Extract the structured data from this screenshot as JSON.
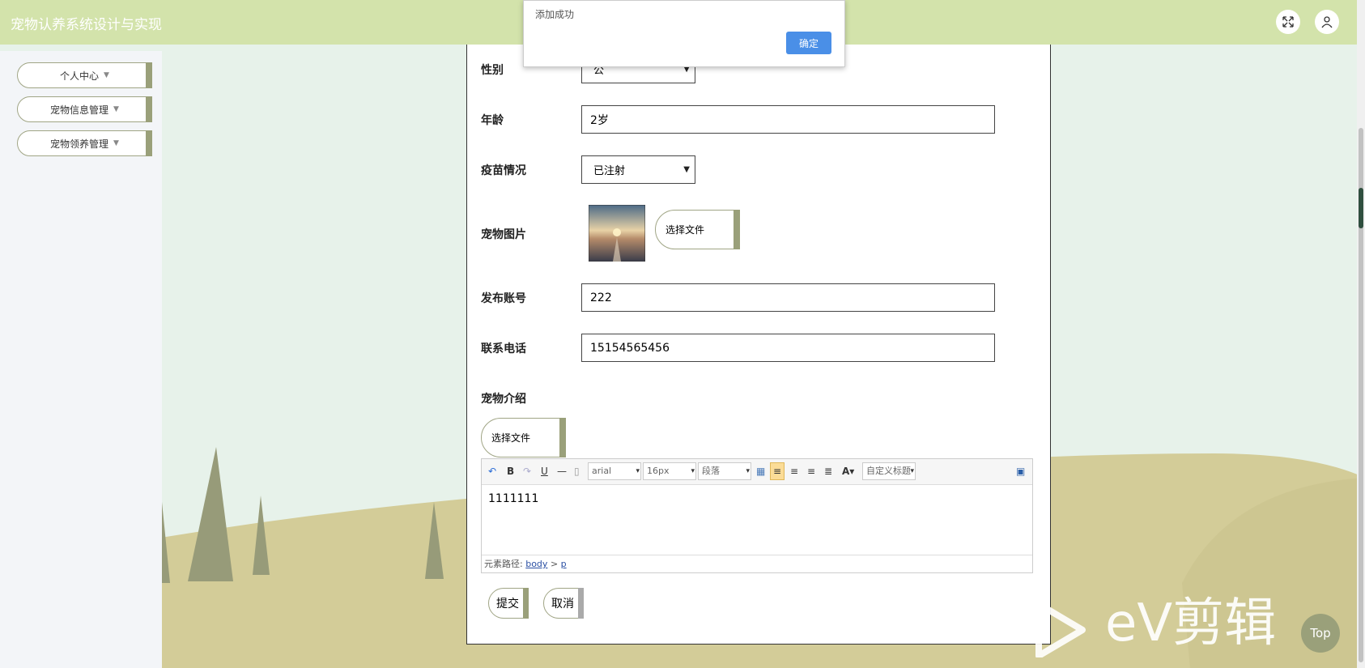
{
  "header": {
    "title": "宠物认养系统设计与实现",
    "icons": [
      "fullscreen-icon",
      "user-icon"
    ]
  },
  "sidebar": {
    "items": [
      {
        "label": "个人中心"
      },
      {
        "label": "宠物信息管理"
      },
      {
        "label": "宠物领养管理"
      }
    ]
  },
  "form": {
    "gender": {
      "label": "性别",
      "value": "公"
    },
    "age": {
      "label": "年龄",
      "value": "2岁"
    },
    "vaccine": {
      "label": "疫苗情况",
      "value": "已注射"
    },
    "image": {
      "label": "宠物图片",
      "button": "选择文件"
    },
    "account": {
      "label": "发布账号",
      "value": "222"
    },
    "phone": {
      "label": "联系电话",
      "value": "15154565456"
    },
    "intro": {
      "label": "宠物介绍",
      "button": "选择文件"
    },
    "editor": {
      "font": "arial",
      "size": "16px",
      "paragraph": "段落",
      "custom_title": "自定义标题",
      "content": "1111111",
      "path_label": "元素路径:",
      "path_body": "body",
      "path_sep": ">",
      "path_p": "p"
    },
    "submit": "提交",
    "cancel": "取消"
  },
  "alert": {
    "message": "添加成功",
    "ok": "确定"
  },
  "watermark": "eV剪辑",
  "top_button": "Top",
  "colors": {
    "header_bg": "#d3e3ab",
    "accent": "#9aa07a",
    "alert_button": "#4a8fe7"
  }
}
